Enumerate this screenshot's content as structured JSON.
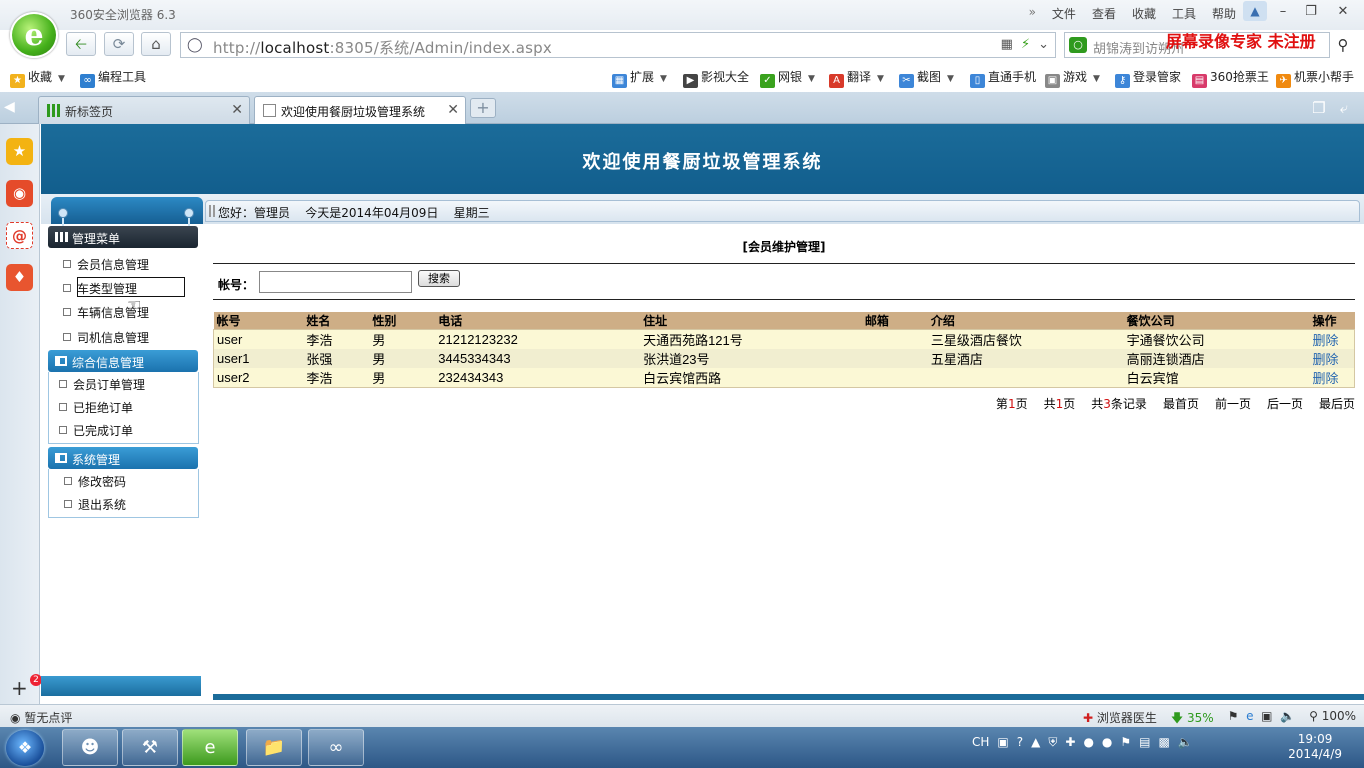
{
  "browser": {
    "app_title": "360安全浏览器 6.3",
    "menu": [
      "文件",
      "查看",
      "收藏",
      "工具",
      "帮助"
    ],
    "url_prefix": "http://",
    "url_host": "localhost",
    "url_rest": ":8305/系统/Admin/index.aspx",
    "search_placeholder": "胡锦涛到访朔州",
    "watermark": "屏幕录像专家  未注册",
    "favorites": [
      {
        "label": "收藏",
        "icon": "star-folder-icon"
      },
      {
        "label": "编程工具",
        "icon": "tool-link-icon"
      }
    ],
    "toolbar_items": [
      {
        "label": "扩展",
        "icon": "extension-icon"
      },
      {
        "label": "影视大全",
        "icon": "video-icon"
      },
      {
        "label": "网银",
        "icon": "bank-shield-icon"
      },
      {
        "label": "翻译",
        "icon": "translate-icon"
      },
      {
        "label": "截图",
        "icon": "screenshot-icon"
      },
      {
        "label": "直通手机",
        "icon": "phone-icon"
      },
      {
        "label": "游戏",
        "icon": "gamepad-icon"
      },
      {
        "label": "登录管家",
        "icon": "key-icon"
      },
      {
        "label": "360抢票王",
        "icon": "ticket-icon"
      },
      {
        "label": "机票小帮手",
        "icon": "plane-icon"
      }
    ],
    "tabs": [
      {
        "label": "新标签页",
        "active": false
      },
      {
        "label": "欢迎使用餐厨垃圾管理系统",
        "active": true
      }
    ],
    "sidebar_badge": "2"
  },
  "page": {
    "banner_title": "欢迎使用餐厨垃圾管理系统",
    "welcome": {
      "greeting": "您好：管理员",
      "date": "今天是2014年04月09日",
      "weekday": "星期三"
    },
    "menu_title": "管理菜单",
    "admin_items": [
      "会员信息管理",
      "车类型管理",
      "车辆信息管理",
      "司机信息管理"
    ],
    "general_title": "综合信息管理",
    "general_items": [
      "会员订单管理",
      "已拒绝订单",
      "已完成订单"
    ],
    "system_title": "系统管理",
    "system_items": [
      "修改密码",
      "退出系统"
    ],
    "content_title": "[会员维护管理]",
    "search": {
      "label": "帐号：",
      "value": "",
      "button": "搜索"
    },
    "table": {
      "columns": [
        "帐号",
        "姓名",
        "性别",
        "电话",
        "住址",
        "邮箱",
        "介绍",
        "餐饮公司",
        "操作"
      ],
      "rows": [
        {
          "account": "user",
          "name": "李浩",
          "gender": "男",
          "phone": "21212123232",
          "address": "天通西苑路121号",
          "email": "",
          "intro": "三星级酒店餐饮",
          "company": "宇通餐饮公司",
          "action": "删除"
        },
        {
          "account": "user1",
          "name": "张强",
          "gender": "男",
          "phone": "3445334343",
          "address": "张洪道23号",
          "email": "",
          "intro": "五星酒店",
          "company": "高丽连锁酒店",
          "action": "删除"
        },
        {
          "account": "user2",
          "name": "李浩",
          "gender": "男",
          "phone": "232434343",
          "address": "白云宾馆西路",
          "email": "",
          "intro": "",
          "company": "白云宾馆",
          "action": "删除"
        }
      ]
    },
    "pager": {
      "page_prefix": "第",
      "page_num": "1",
      "page_suffix": "页",
      "total_prefix": "共",
      "total_pages": "1",
      "total_suffix": "页",
      "rec_prefix": "共",
      "records": "3",
      "rec_suffix": "条记录",
      "first": "最首页",
      "prev": "前一页",
      "next": "后一页",
      "last": "最后页"
    }
  },
  "statusbar": {
    "left": "暂无点评",
    "doctor": "浏览器医生",
    "speed": "35%",
    "zoom": "100%"
  },
  "taskbar": {
    "lang": "CH",
    "time": "19:09",
    "date": "2014/4/9"
  }
}
